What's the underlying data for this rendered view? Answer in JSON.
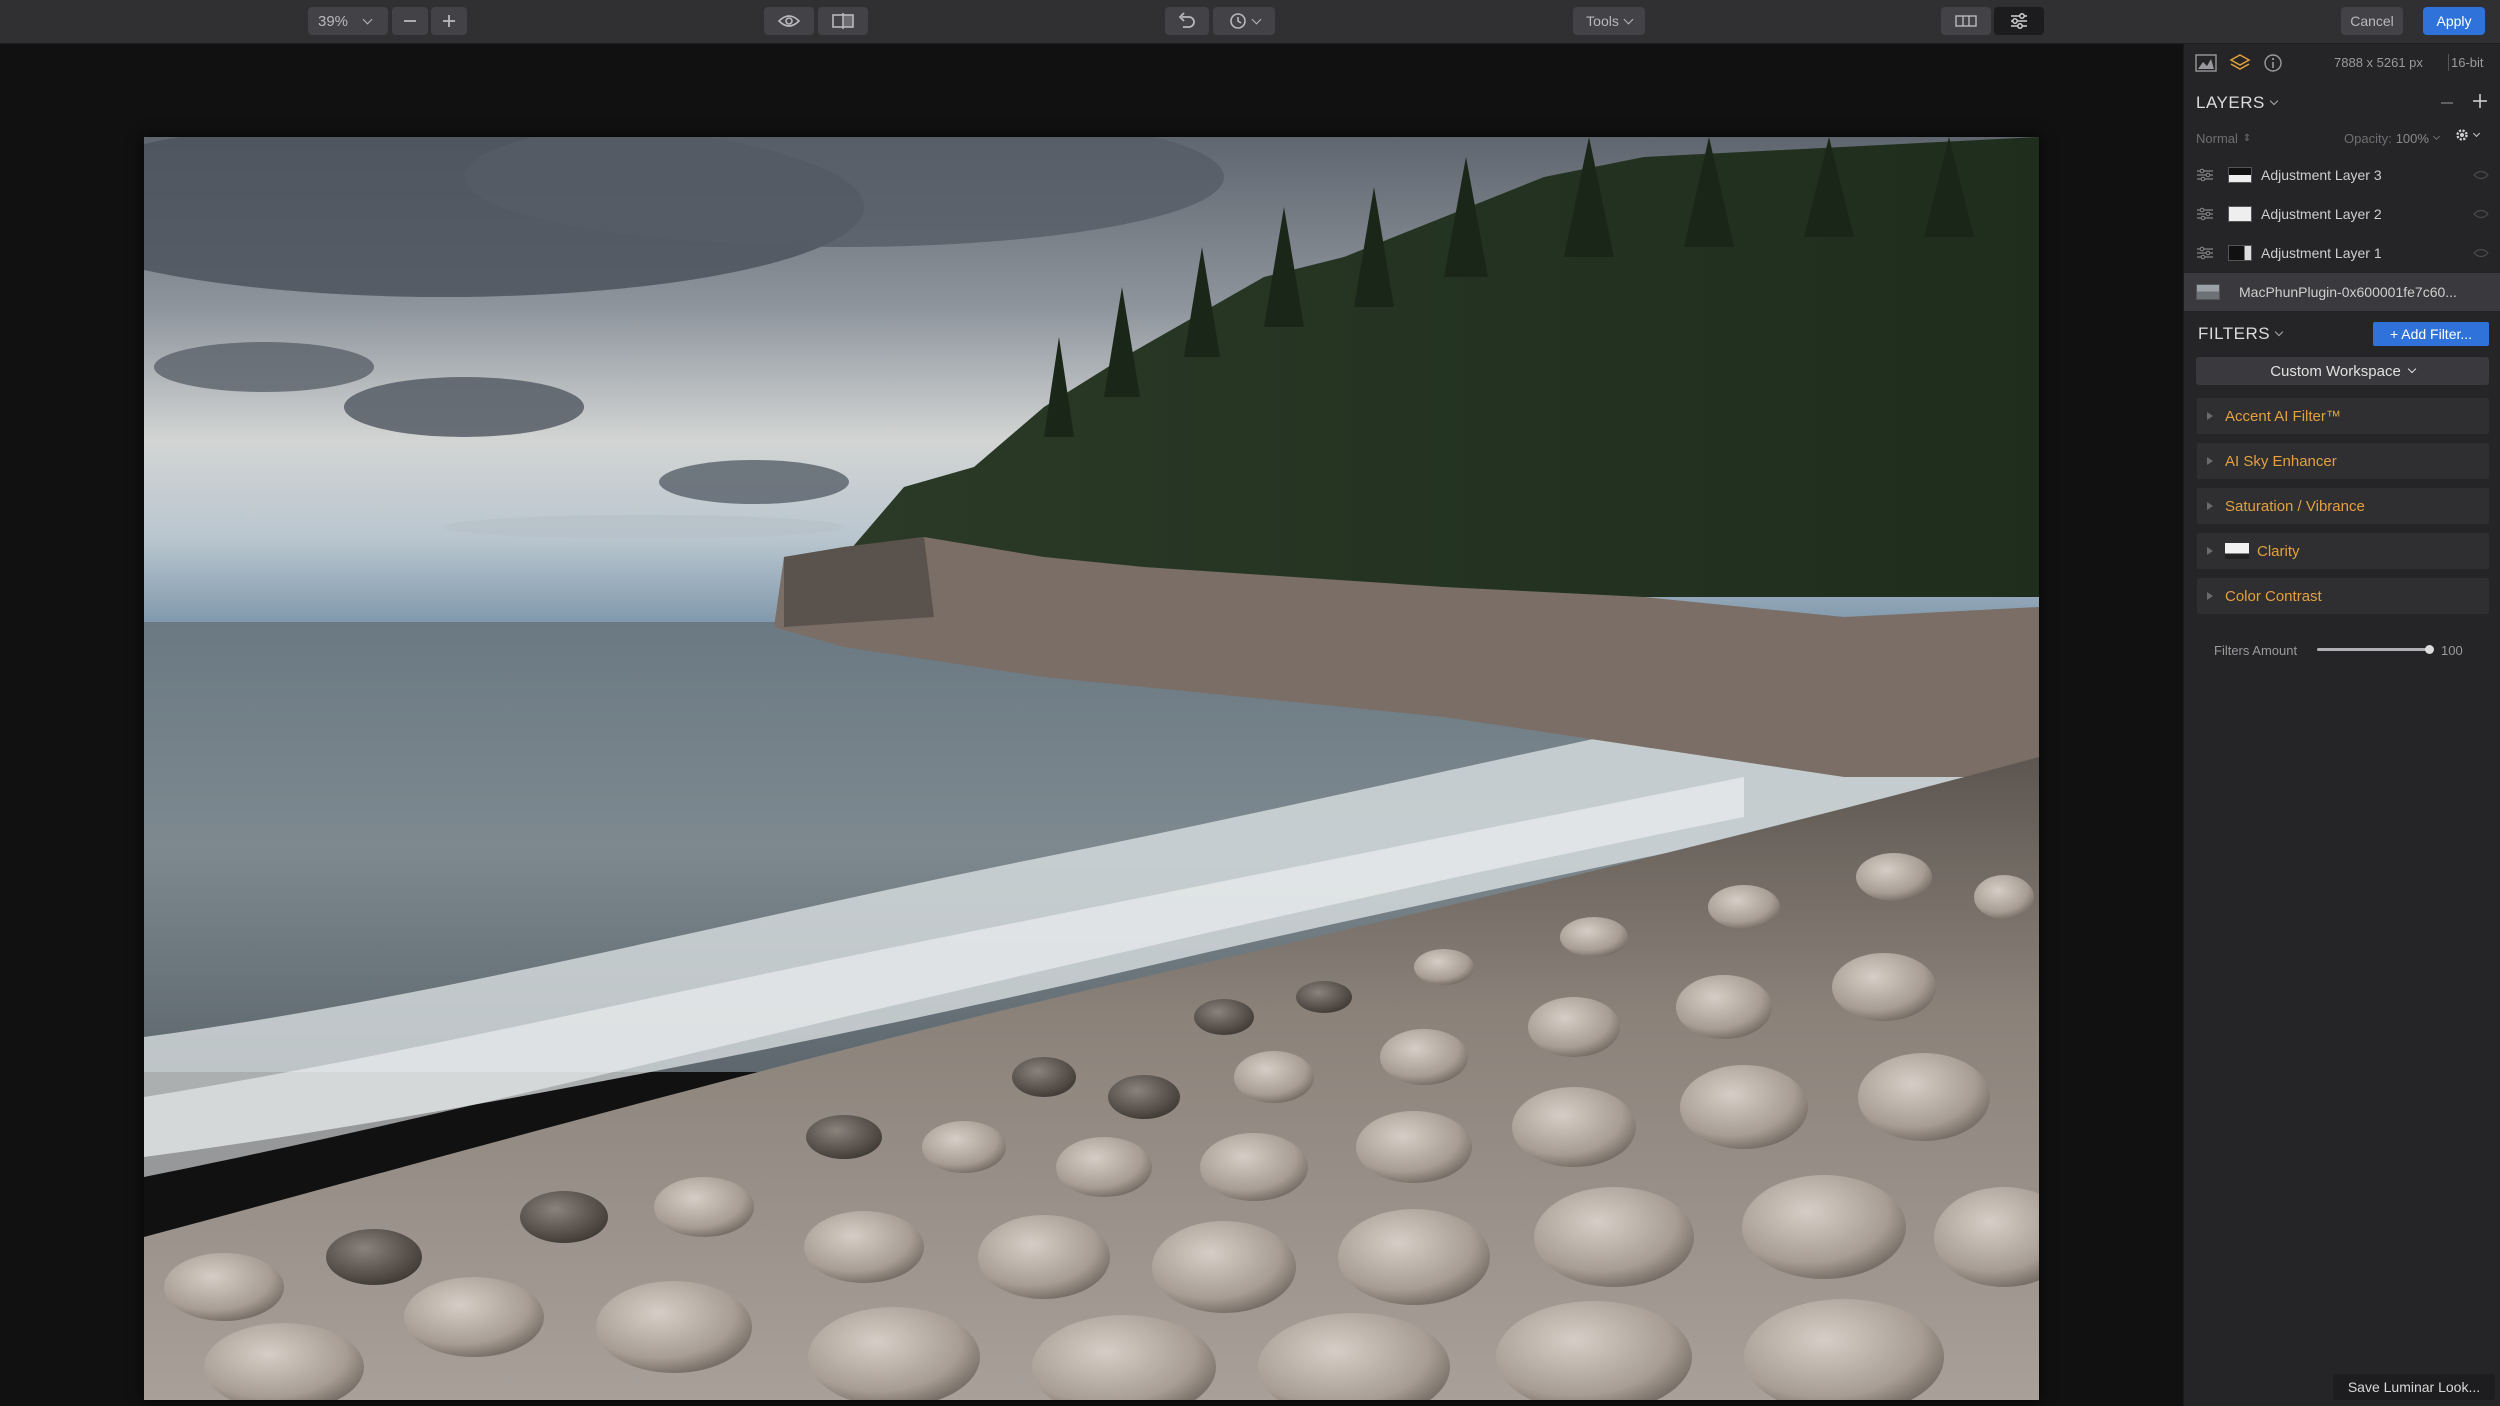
{
  "toolbar": {
    "zoom_label": "39%",
    "tools_label": "Tools",
    "cancel_label": "Cancel",
    "apply_label": "Apply"
  },
  "panel": {
    "image_size": "7888 x 5261 px",
    "bit_depth": "16-bit",
    "layers_title": "LAYERS",
    "blend_mode": "Normal",
    "opacity_label": "Opacity:",
    "opacity_value": "100%",
    "layers": [
      {
        "name": "Adjustment Layer 3"
      },
      {
        "name": "Adjustment Layer 2"
      },
      {
        "name": "Adjustment Layer 1"
      },
      {
        "name": "MacPhunPlugin-0x600001fe7c60..."
      }
    ],
    "filters_title": "FILTERS",
    "add_filter_label": "+ Add Filter...",
    "workspace_label": "Custom Workspace",
    "filters": [
      {
        "name": "Accent AI Filter™"
      },
      {
        "name": "AI Sky Enhancer"
      },
      {
        "name": "Saturation / Vibrance"
      },
      {
        "name": "Clarity"
      },
      {
        "name": "Color Contrast"
      }
    ],
    "filters_amount_label": "Filters Amount",
    "filters_amount_value": "100",
    "filters_amount_fraction": 1.0,
    "save_look_label": "Save Luminar Look..."
  },
  "colors": {
    "accent": "#2f73da",
    "filter_name": "#e2a13c"
  }
}
